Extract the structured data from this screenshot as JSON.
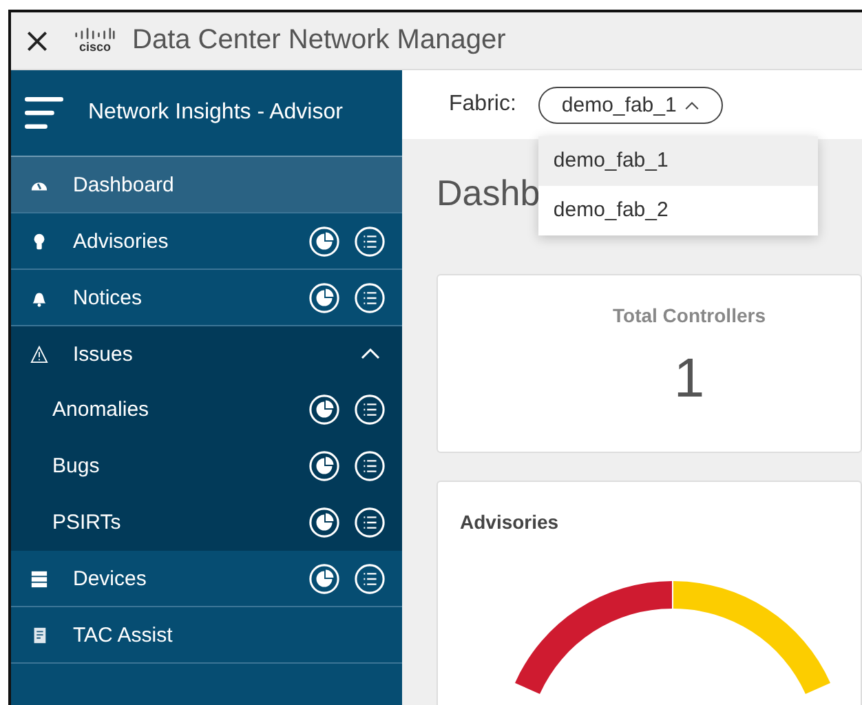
{
  "window": {
    "title": "Data Center Network Manager",
    "brand": "cisco"
  },
  "sidebar": {
    "title": "Network Insights - Advisor",
    "items": [
      {
        "label": "Dashboard",
        "kind": "gauge",
        "selected": true,
        "actions": false
      },
      {
        "label": "Advisories",
        "kind": "bulb",
        "selected": false,
        "actions": true
      },
      {
        "label": "Notices",
        "kind": "bell",
        "selected": false,
        "actions": true
      },
      {
        "label": "Issues",
        "kind": "warning",
        "selected": false,
        "actions": false,
        "expanded": true,
        "children": [
          {
            "label": "Anomalies",
            "selected": false,
            "actions": true
          },
          {
            "label": "Bugs",
            "selected": false,
            "actions": true
          },
          {
            "label": "PSIRTs",
            "selected": false,
            "actions": true
          }
        ]
      },
      {
        "label": "Devices",
        "kind": "server",
        "selected": false,
        "actions": true
      },
      {
        "label": "TAC Assist",
        "kind": "doc",
        "selected": false,
        "actions": false
      }
    ]
  },
  "fabric": {
    "label": "Fabric:",
    "value": "demo_fab_1",
    "expanded": true,
    "options": [
      {
        "label": "demo_fab_1",
        "selected": true
      },
      {
        "label": "demo_fab_2",
        "selected": false
      }
    ]
  },
  "page_title": "Dashb",
  "cards": [
    {
      "title": "Total Controllers",
      "value": "1"
    },
    {
      "title": "Advisories"
    }
  ]
}
